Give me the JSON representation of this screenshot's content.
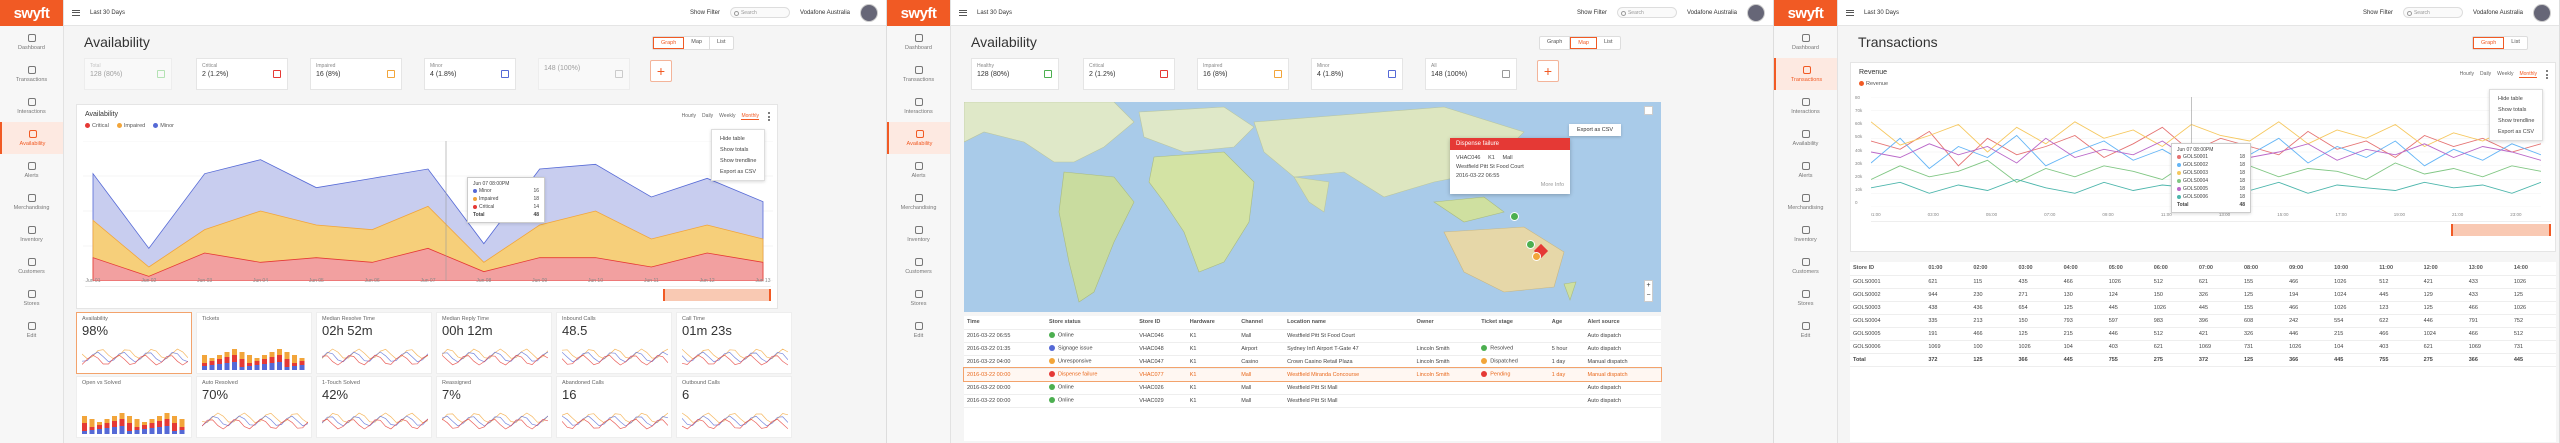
{
  "brand": {
    "logo": "swyft",
    "accent": "#f15a24"
  },
  "nav": [
    "Dashboard",
    "Transactions",
    "Interactions",
    "Availability",
    "Alerts",
    "Merchandising",
    "Inventory",
    "Customers",
    "Stores",
    "Edit"
  ],
  "topbar": {
    "range": "Last 30 Days",
    "filter": "Show Filter",
    "search_placeholder": "Search",
    "account": "Vodafone Australia"
  },
  "panels": {
    "p1": {
      "title": "Availability",
      "views": [
        "Graph",
        "Map",
        "List"
      ],
      "kpis": [
        {
          "label": "Total",
          "value": "128 (80%)"
        },
        {
          "label": "Critical",
          "value": "2 (1.2%)"
        },
        {
          "label": "Impaired",
          "value": "16 (8%)"
        },
        {
          "label": "Minor",
          "value": "4 (1.8%)"
        },
        {
          "label": "",
          "value": "148 (100%)"
        }
      ],
      "chart_title": "Availability",
      "legend": [
        "Critical",
        "Impaired",
        "Minor"
      ],
      "periods": [
        "Hourly",
        "Daily",
        "Weekly",
        "Monthly"
      ],
      "menu": [
        "Hide table",
        "Show totals",
        "Show trendline",
        "Export as CSV"
      ],
      "tooltip": {
        "title": "Jun 07 08:00PM",
        "rows": [
          [
            "Minor",
            "16"
          ],
          [
            "Impaired",
            "18"
          ],
          [
            "Critical",
            "14"
          ]
        ],
        "total": [
          "Total",
          "48"
        ]
      },
      "xticks": [
        "Jun 01",
        "Jun 02",
        "Jun 03",
        "Jun 04",
        "Jun 05",
        "Jun 06",
        "Jun 07",
        "Jun 08",
        "Jun 09",
        "Jun 10",
        "Jun 11",
        "Jun 12",
        "Jun 13"
      ],
      "metrics": [
        {
          "label": "Availability",
          "value": "98%"
        },
        {
          "label": "Tickets",
          "value": ""
        },
        {
          "label": "Median Resolve Time",
          "value": "02h 52m"
        },
        {
          "label": "Median Reply Time",
          "value": "00h 12m"
        },
        {
          "label": "Inbound Calls",
          "value": "48.5"
        },
        {
          "label": "Call Time",
          "value": "01m 23s"
        },
        {
          "label": "Open vs Solved",
          "value": ""
        },
        {
          "label": "Auto Resolved",
          "value": "70%"
        },
        {
          "label": "1-Touch Solved",
          "value": "42%"
        },
        {
          "label": "Reassigned",
          "value": "7%"
        },
        {
          "label": "Abandoned Calls",
          "value": "16"
        },
        {
          "label": "Outbound Calls",
          "value": "6"
        }
      ]
    },
    "p2": {
      "title": "Availability",
      "views": [
        "Graph",
        "Map",
        "List"
      ],
      "kpis": [
        {
          "label": "Healthy",
          "value": "128 (80%)"
        },
        {
          "label": "Critical",
          "value": "2 (1.2%)"
        },
        {
          "label": "Impaired",
          "value": "16 (8%)"
        },
        {
          "label": "Minor",
          "value": "4 (1.8%)"
        },
        {
          "label": "All",
          "value": "148 (100%)"
        }
      ],
      "export": "Export as CSV",
      "popup": {
        "title": "Dispense failure",
        "id": "VHAC046",
        "hw": "K1",
        "ch": "Mall",
        "loc": "Westfield Pitt St Food Court",
        "ts": "2016-03-22 06:55",
        "more": "More Info"
      },
      "columns": [
        "Time",
        "Store status",
        "Store ID",
        "Hardware",
        "Channel",
        "Location name",
        "Owner",
        "Ticket stage",
        "Age",
        "Alert source"
      ],
      "rows": [
        [
          "2016-03-22 06:55",
          "Online",
          "VHAC046",
          "K1",
          "Mall",
          "Westfield Pitt St Food Court",
          "",
          "",
          "",
          "Auto dispatch"
        ],
        [
          "2016-03-22 01:35",
          "Signage issue",
          "VHAC048",
          "K1",
          "Airport",
          "Sydney Int'l Airport T-Gate 47",
          "Lincoln Smith",
          "Resolved",
          "5 hour",
          "Auto dispatch"
        ],
        [
          "2016-03-22 04:00",
          "Unresponsive",
          "VHAC047",
          "K1",
          "Casino",
          "Crown Casino Retail Plaza",
          "Lincoln Smith",
          "Dispatched",
          "1 day",
          "Manual dispatch"
        ],
        [
          "2016-03-22 00:00",
          "Dispense failure",
          "VHAC077",
          "K1",
          "Mall",
          "Westfield Miranda Concourse",
          "Lincoln Smith",
          "Pending",
          "1 day",
          "Manual dispatch"
        ],
        [
          "2016-03-22 00:00",
          "Online",
          "VHAC026",
          "K1",
          "Mall",
          "Westfield Pitt St Mall",
          "",
          "",
          "",
          "Auto dispatch"
        ],
        [
          "2016-03-22 00:00",
          "Online",
          "VHAC029",
          "K1",
          "Mall",
          "Westfield Pitt St Mall",
          "",
          "",
          "",
          "Auto dispatch"
        ]
      ]
    },
    "p3": {
      "title": "Transactions",
      "views": [
        "Graph",
        "List"
      ],
      "chart_title": "Revenue",
      "legend": [
        "Revenue"
      ],
      "periods": [
        "Hourly",
        "Daily",
        "Weekly",
        "Monthly"
      ],
      "menu": [
        "Hide table",
        "Show totals",
        "Show trendline",
        "Export as CSV"
      ],
      "tooltip": {
        "title": "Jun 07 08:00PM",
        "rows": [
          [
            "GOLS0001",
            "18"
          ],
          [
            "GOLS0002",
            "18"
          ],
          [
            "GOLS0003",
            "18"
          ],
          [
            "GOLS0004",
            "18"
          ],
          [
            "GOLS0005",
            "18"
          ],
          [
            "GOLS0006",
            "18"
          ]
        ],
        "total": [
          "Total",
          "48"
        ]
      },
      "yticks": [
        "80",
        "70k",
        "60k",
        "50k",
        "40k",
        "30k",
        "20k",
        "10k",
        "0"
      ],
      "columns": [
        "Store ID",
        "01:00",
        "02:00",
        "03:00",
        "04:00",
        "05:00",
        "06:00",
        "07:00",
        "08:00",
        "09:00",
        "10:00",
        "11:00",
        "12:00",
        "13:00",
        "14:00"
      ],
      "rows": [
        [
          "GOLS0001",
          "621",
          "115",
          "435",
          "466",
          "1026",
          "512",
          "621",
          "155",
          "466",
          "1026",
          "512",
          "421",
          "433",
          "1026"
        ],
        [
          "GOLS0002",
          "944",
          "230",
          "271",
          "130",
          "124",
          "150",
          "326",
          "125",
          "194",
          "1024",
          "445",
          "129",
          "433",
          "125"
        ],
        [
          "GOLS0003",
          "438",
          "436",
          "654",
          "125",
          "445",
          "1026",
          "445",
          "155",
          "466",
          "1026",
          "123",
          "125",
          "466",
          "1026"
        ],
        [
          "GOLS0004",
          "335",
          "213",
          "150",
          "793",
          "597",
          "983",
          "396",
          "608",
          "242",
          "554",
          "622",
          "446",
          "791",
          "752"
        ],
        [
          "GOLS0005",
          "191",
          "466",
          "125",
          "215",
          "446",
          "512",
          "421",
          "326",
          "446",
          "215",
          "466",
          "1024",
          "466",
          "512"
        ],
        [
          "GOLS0006",
          "1069",
          "100",
          "1026",
          "104",
          "403",
          "621",
          "1069",
          "731",
          "1026",
          "104",
          "403",
          "621",
          "1069",
          "731"
        ]
      ],
      "total": [
        "Total",
        "372",
        "125",
        "366",
        "445",
        "755",
        "275",
        "372",
        "125",
        "366",
        "445",
        "755",
        "275",
        "366",
        "445"
      ]
    }
  },
  "chart_data": [
    {
      "type": "area",
      "title": "Availability",
      "categories": [
        "Jun 01",
        "Jun 02",
        "Jun 03",
        "Jun 04",
        "Jun 05",
        "Jun 06",
        "Jun 07",
        "Jun 08",
        "Jun 09",
        "Jun 10",
        "Jun 11",
        "Jun 12",
        "Jun 13"
      ],
      "series": [
        {
          "name": "Critical",
          "color": "#f2a0a0",
          "values": [
            10,
            2,
            12,
            8,
            10,
            8,
            14,
            4,
            10,
            10,
            6,
            12,
            8
          ]
        },
        {
          "name": "Impaired",
          "color": "#f6cf7a",
          "values": [
            26,
            6,
            22,
            30,
            24,
            22,
            32,
            8,
            24,
            30,
            18,
            24,
            18
          ]
        },
        {
          "name": "Minor",
          "color": "#c8cdef",
          "values": [
            46,
            14,
            46,
            52,
            40,
            44,
            48,
            16,
            48,
            50,
            36,
            44,
            34
          ]
        }
      ],
      "ylim": [
        0,
        60
      ]
    },
    {
      "type": "line",
      "title": "Revenue",
      "categories": [
        "01:00",
        "02:00",
        "03:00",
        "04:00",
        "05:00",
        "06:00",
        "07:00",
        "08:00",
        "09:00",
        "10:00",
        "11:00",
        "12:00",
        "13:00",
        "14:00",
        "15:00",
        "16:00",
        "17:00",
        "18:00",
        "19:00",
        "20:00",
        "21:00",
        "22:00",
        "23:00",
        "24:00"
      ],
      "series": [
        {
          "name": "GOLS0001",
          "color": "#e57373",
          "values": [
            48,
            42,
            55,
            30,
            50,
            38,
            44,
            52,
            36,
            46,
            58,
            40,
            50,
            44,
            38,
            55,
            42,
            48,
            36,
            52,
            44,
            50,
            40,
            46
          ]
        },
        {
          "name": "GOLS0002",
          "color": "#64b5f6",
          "values": [
            32,
            50,
            28,
            44,
            36,
            52,
            30,
            40,
            48,
            34,
            42,
            30,
            46,
            38,
            50,
            32,
            44,
            36,
            48,
            30,
            42,
            34,
            46,
            38
          ]
        },
        {
          "name": "GOLS0003",
          "color": "#f6c85f",
          "values": [
            62,
            45,
            52,
            60,
            40,
            58,
            46,
            62,
            50,
            56,
            44,
            60,
            52,
            48,
            62,
            46,
            56,
            50,
            60,
            44,
            54,
            48,
            58,
            50
          ]
        },
        {
          "name": "GOLS0004",
          "color": "#81c784",
          "values": [
            20,
            30,
            22,
            26,
            34,
            18,
            28,
            22,
            30,
            26,
            20,
            34,
            24,
            30,
            22,
            28,
            26,
            20,
            32,
            24,
            28,
            22,
            30,
            26
          ]
        },
        {
          "name": "GOLS0005",
          "color": "#ba68c8",
          "values": [
            40,
            36,
            46,
            38,
            44,
            32,
            50,
            36,
            42,
            38,
            48,
            34,
            44,
            36,
            40,
            46,
            34,
            42,
            38,
            46,
            36,
            44,
            40,
            34
          ]
        },
        {
          "name": "GOLS0006",
          "color": "#4db6ac",
          "values": [
            14,
            18,
            10,
            16,
            12,
            20,
            14,
            10,
            18,
            12,
            16,
            14,
            20,
            12,
            18,
            10,
            16,
            14,
            12,
            18,
            14,
            16,
            10,
            18
          ]
        }
      ],
      "ylim": [
        0,
        80
      ]
    }
  ]
}
